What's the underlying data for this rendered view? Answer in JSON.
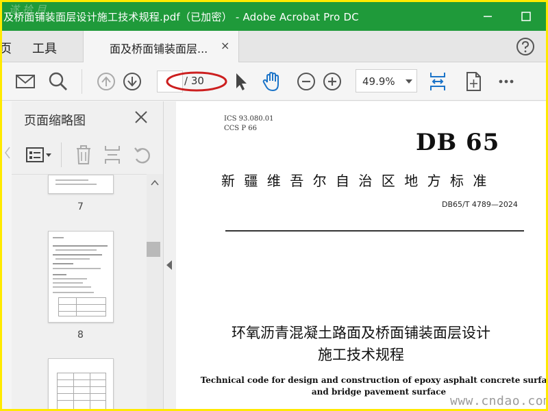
{
  "window": {
    "title": "及桥面铺装面层设计施工技术规程.pdf（已加密） - Adobe Acrobat Pro DC",
    "minimize_icon": "minimize-icon",
    "maximize_icon": "maximize-icon",
    "corner_text": "遂 拾 目"
  },
  "tabs": {
    "home_partial": "页",
    "tools": "工具",
    "document": "面及桥面铺装面层...",
    "close_glyph": "×"
  },
  "toolbar": {
    "page_total": "/ 30",
    "zoom": "49.9%"
  },
  "sidebar": {
    "heading": "页面缩略图",
    "thumbnails": [
      {
        "number": "7"
      },
      {
        "number": "8"
      }
    ]
  },
  "document": {
    "ics": "ICS  93.080.01",
    "ccs": "CCS  P  66",
    "logo": "DB 65",
    "standard_title": "新疆维吾尔自治区地方标准",
    "standard_number": "DB65/T 4789—2024",
    "cn_title_line1": "环氧沥青混凝土路面及桥面铺装面层设计",
    "cn_title_line2": "施工技术规程",
    "en_title_line1": "Technical code for design and construction of epoxy asphalt concrete surface",
    "en_title_line2": "and bridge pavement surface"
  },
  "watermark": "www.cndao.com",
  "colors": {
    "titlebar": "#1f9a3a",
    "frame": "#ffea00",
    "highlight": "#cc1f1f",
    "accent_blue": "#1a73c8"
  }
}
